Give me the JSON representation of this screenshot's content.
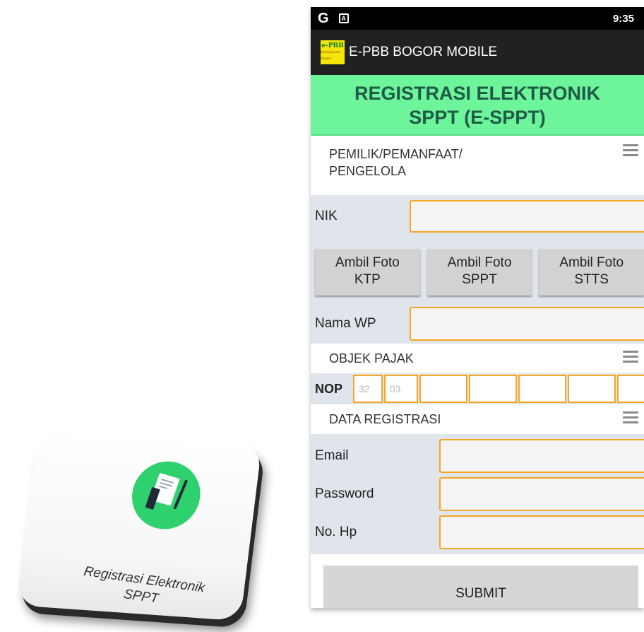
{
  "tile": {
    "icon": "document-pen-icon",
    "label_line1": "Registrasi Elektronik",
    "label_line2": "SPPT",
    "accent": "#2fd06e"
  },
  "statusbar": {
    "left_icon_g": "G",
    "notification_icon": "A",
    "time": "9:35"
  },
  "appbar": {
    "logo_text": "e-PBB",
    "logo_subtext": "Kabupaten Bogor",
    "title": "E-PBB BOGOR MOBILE"
  },
  "banner": {
    "line1": "REGISTRASI ELEKTRONIK",
    "line2": "SPPT (E-SPPT)",
    "color": "#6ef59b"
  },
  "sections": {
    "owner": {
      "line1": "PEMILIK/PEMANFAAT/",
      "line2": "PENGELOLA"
    },
    "object": {
      "title": "OBJEK PAJAK"
    },
    "registration": {
      "title": "DATA REGISTRASI"
    }
  },
  "fields": {
    "nik_label": "NIK",
    "nama_label": "Nama WP",
    "nop_label": "NOP",
    "nop_prefill": [
      "32",
      "03"
    ],
    "email_label": "Email",
    "password_label": "Password",
    "hp_label": "No. Hp"
  },
  "photo_buttons": [
    {
      "line1": "Ambil Foto",
      "line2": "KTP"
    },
    {
      "line1": "Ambil Foto",
      "line2": "SPPT"
    },
    {
      "line1": "Ambil Foto",
      "line2": "STTS"
    }
  ],
  "submit_label": "SUBMIT",
  "colors": {
    "field_border": "#f5a623",
    "row_bg": "#dfe5ea",
    "appbar": "#212121"
  }
}
